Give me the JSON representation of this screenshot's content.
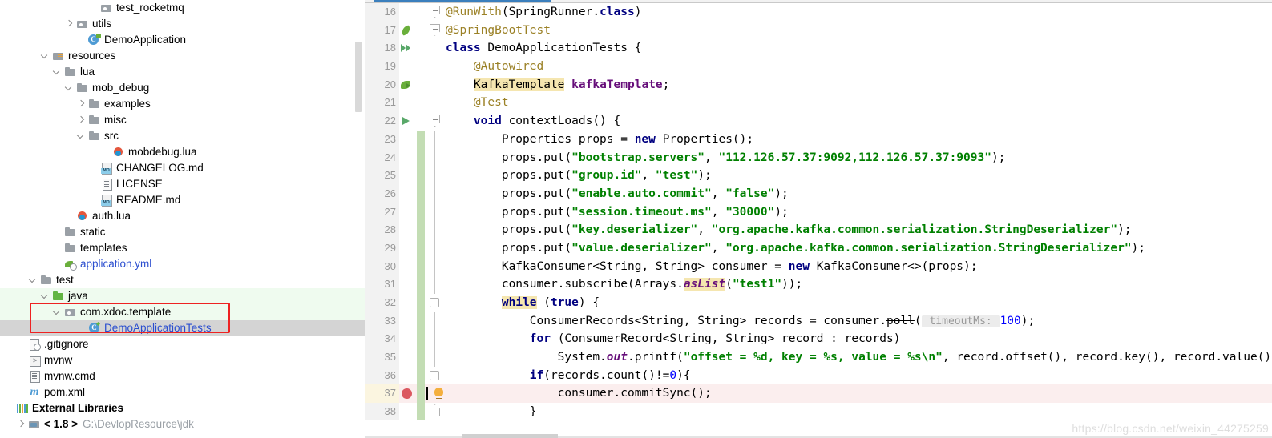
{
  "project_tree": {
    "name": "Project tool window",
    "scrollbar": true,
    "items": [
      {
        "label": "test_rocketmq",
        "indent": 7,
        "arrow": "none",
        "icon": "folder-dot-icon",
        "style": "plain"
      },
      {
        "label": "utils",
        "indent": 5,
        "arrow": "right",
        "icon": "folder-dot-icon",
        "style": "plain"
      },
      {
        "label": "DemoApplication",
        "indent": 6,
        "arrow": "none",
        "icon": "class-spring-icon",
        "style": "plain"
      },
      {
        "label": "resources",
        "indent": 3,
        "arrow": "down",
        "icon": "folder-resources-icon",
        "style": "plain"
      },
      {
        "label": "lua",
        "indent": 4,
        "arrow": "down",
        "icon": "folder-icon",
        "style": "plain"
      },
      {
        "label": "mob_debug",
        "indent": 5,
        "arrow": "down",
        "icon": "folder-icon",
        "style": "plain"
      },
      {
        "label": "examples",
        "indent": 6,
        "arrow": "right",
        "icon": "folder-icon",
        "style": "plain"
      },
      {
        "label": "misc",
        "indent": 6,
        "arrow": "right",
        "icon": "folder-icon",
        "style": "plain"
      },
      {
        "label": "src",
        "indent": 6,
        "arrow": "down",
        "icon": "folder-icon",
        "style": "plain"
      },
      {
        "label": "mobdebug.lua",
        "indent": 8,
        "arrow": "none",
        "icon": "lua-file-icon",
        "style": "plain"
      },
      {
        "label": "CHANGELOG.md",
        "indent": 7,
        "arrow": "none",
        "icon": "markdown-icon",
        "style": "plain"
      },
      {
        "label": "LICENSE",
        "indent": 7,
        "arrow": "none",
        "icon": "file-icon",
        "style": "plain"
      },
      {
        "label": "README.md",
        "indent": 7,
        "arrow": "none",
        "icon": "markdown-icon",
        "style": "plain"
      },
      {
        "label": "auth.lua",
        "indent": 5,
        "arrow": "none",
        "icon": "lua-file-icon",
        "style": "plain"
      },
      {
        "label": "static",
        "indent": 4,
        "arrow": "none",
        "icon": "folder-icon",
        "style": "plain"
      },
      {
        "label": "templates",
        "indent": 4,
        "arrow": "none",
        "icon": "folder-icon",
        "style": "plain"
      },
      {
        "label": "application.yml",
        "indent": 4,
        "arrow": "none",
        "icon": "yml-icon",
        "style": "blue"
      },
      {
        "label": "test",
        "indent": 2,
        "arrow": "down",
        "icon": "folder-icon",
        "style": "plain"
      },
      {
        "label": "java",
        "indent": 3,
        "arrow": "down",
        "icon": "folder-green-icon",
        "style": "plain",
        "row": "src-root"
      },
      {
        "label": "com.xdoc.template",
        "indent": 4,
        "arrow": "down",
        "icon": "folder-dot-icon",
        "style": "plain",
        "row": "src-root"
      },
      {
        "label": "DemoApplicationTests",
        "indent": 6,
        "arrow": "none",
        "icon": "class-icon",
        "style": "blue",
        "row": "selected"
      },
      {
        "label": ".gitignore",
        "indent": 1,
        "arrow": "none",
        "icon": "gitignore-icon",
        "style": "plain"
      },
      {
        "label": "mvnw",
        "indent": 1,
        "arrow": "none",
        "icon": "shell-script-icon",
        "style": "plain"
      },
      {
        "label": "mvnw.cmd",
        "indent": 1,
        "arrow": "none",
        "icon": "file-icon",
        "style": "plain"
      },
      {
        "label": "pom.xml",
        "indent": 1,
        "arrow": "none",
        "icon": "maven-icon",
        "style": "plain"
      },
      {
        "label": "External Libraries",
        "indent": 0,
        "arrow": "none",
        "icon": "external-libraries-icon",
        "style": "bold"
      },
      {
        "label": "< 1.8 >",
        "indent": 1,
        "arrow": "right",
        "icon": "jdk-icon",
        "style": "bold",
        "suffix": "G:\\DevlopResource\\jdk"
      }
    ],
    "annotation_box_color": "#ee2222"
  },
  "editor": {
    "name": "code-editor",
    "active_tab_indicator_color": "#3b7fbd",
    "lines": [
      {
        "num": "16",
        "gutter_icon": "none",
        "fold": "fold-tag",
        "tokens": [
          {
            "t": "@RunWith",
            "c": "anno"
          },
          {
            "t": "(SpringRunner.",
            "c": "plain"
          },
          {
            "t": "class",
            "c": "kw"
          },
          {
            "t": ")",
            "c": "plain"
          }
        ]
      },
      {
        "num": "17",
        "gutter_icon": "spring-leaf-icon",
        "fold": "fold-tag",
        "tokens": [
          {
            "t": "@SpringBootTest",
            "c": "anno"
          }
        ]
      },
      {
        "num": "18",
        "gutter_icon": "run-all-tests-icon",
        "fold": "none",
        "tokens": [
          {
            "t": "class",
            "c": "kw"
          },
          {
            "t": " DemoApplicationTests {",
            "c": "plain"
          }
        ]
      },
      {
        "num": "19",
        "gutter_icon": "none",
        "fold": "none",
        "tokens": [
          {
            "t": "    @Autowired",
            "c": "anno"
          }
        ]
      },
      {
        "num": "20",
        "gutter_icon": "spring-bean-icon",
        "fold": "none",
        "tokens": [
          {
            "t": "    ",
            "c": "plain"
          },
          {
            "t": "KafkaTemplate",
            "c": "hlsym"
          },
          {
            "t": " ",
            "c": "plain"
          },
          {
            "t": "kafkaTemplate",
            "c": "field"
          },
          {
            "t": ";",
            "c": "plain"
          }
        ]
      },
      {
        "num": "21",
        "gutter_icon": "none",
        "fold": "none",
        "tokens": [
          {
            "t": "    @Test",
            "c": "anno"
          }
        ]
      },
      {
        "num": "22",
        "gutter_icon": "run-test-icon",
        "fold": "fold-tag",
        "tokens": [
          {
            "t": "    ",
            "c": "plain"
          },
          {
            "t": "void",
            "c": "kw"
          },
          {
            "t": " contextLoads() {",
            "c": "plain"
          }
        ]
      },
      {
        "num": "23",
        "gutter_icon": "none",
        "fold": "line",
        "vcs": true,
        "tokens": [
          {
            "t": "        Properties props = ",
            "c": "plain"
          },
          {
            "t": "new",
            "c": "kw"
          },
          {
            "t": " Properties();",
            "c": "plain"
          }
        ]
      },
      {
        "num": "24",
        "gutter_icon": "none",
        "fold": "line",
        "vcs": true,
        "tokens": [
          {
            "t": "        props.put(",
            "c": "plain"
          },
          {
            "t": "\"bootstrap.servers\"",
            "c": "str"
          },
          {
            "t": ", ",
            "c": "plain"
          },
          {
            "t": "\"112.126.57.37:9092,112.126.57.37:9093\"",
            "c": "str"
          },
          {
            "t": ");",
            "c": "plain"
          }
        ]
      },
      {
        "num": "25",
        "gutter_icon": "none",
        "fold": "line",
        "vcs": true,
        "tokens": [
          {
            "t": "        props.put(",
            "c": "plain"
          },
          {
            "t": "\"group.id\"",
            "c": "str"
          },
          {
            "t": ", ",
            "c": "plain"
          },
          {
            "t": "\"test\"",
            "c": "str"
          },
          {
            "t": ");",
            "c": "plain"
          }
        ]
      },
      {
        "num": "26",
        "gutter_icon": "none",
        "fold": "line",
        "vcs": true,
        "tokens": [
          {
            "t": "        props.put(",
            "c": "plain"
          },
          {
            "t": "\"enable.auto.commit\"",
            "c": "str"
          },
          {
            "t": ", ",
            "c": "plain"
          },
          {
            "t": "\"false\"",
            "c": "str"
          },
          {
            "t": ");",
            "c": "plain"
          }
        ]
      },
      {
        "num": "27",
        "gutter_icon": "none",
        "fold": "line",
        "vcs": true,
        "tokens": [
          {
            "t": "        props.put(",
            "c": "plain"
          },
          {
            "t": "\"session.timeout.ms\"",
            "c": "str"
          },
          {
            "t": ", ",
            "c": "plain"
          },
          {
            "t": "\"30000\"",
            "c": "str"
          },
          {
            "t": ");",
            "c": "plain"
          }
        ]
      },
      {
        "num": "28",
        "gutter_icon": "none",
        "fold": "line",
        "vcs": true,
        "tokens": [
          {
            "t": "        props.put(",
            "c": "plain"
          },
          {
            "t": "\"key.deserializer\"",
            "c": "str"
          },
          {
            "t": ", ",
            "c": "plain"
          },
          {
            "t": "\"org.apache.kafka.common.serialization.StringDeserializer\"",
            "c": "str"
          },
          {
            "t": ");",
            "c": "plain"
          }
        ]
      },
      {
        "num": "29",
        "gutter_icon": "none",
        "fold": "line",
        "vcs": true,
        "tokens": [
          {
            "t": "        props.put(",
            "c": "plain"
          },
          {
            "t": "\"value.deserializer\"",
            "c": "str"
          },
          {
            "t": ", ",
            "c": "plain"
          },
          {
            "t": "\"org.apache.kafka.common.serialization.StringDeserializer\"",
            "c": "str"
          },
          {
            "t": ");",
            "c": "plain"
          }
        ]
      },
      {
        "num": "30",
        "gutter_icon": "none",
        "fold": "line",
        "vcs": true,
        "tokens": [
          {
            "t": "        KafkaConsumer<String, String> consumer = ",
            "c": "plain"
          },
          {
            "t": "new",
            "c": "kw"
          },
          {
            "t": " KafkaConsumer<>(props);",
            "c": "plain"
          }
        ]
      },
      {
        "num": "31",
        "gutter_icon": "none",
        "fold": "line",
        "vcs": true,
        "tokens": [
          {
            "t": "        consumer.subscribe(Arrays.",
            "c": "plain"
          },
          {
            "t": "asList",
            "c": "static-it-hl"
          },
          {
            "t": "(",
            "c": "plain"
          },
          {
            "t": "\"test1\"",
            "c": "str"
          },
          {
            "t": "));",
            "c": "plain"
          }
        ]
      },
      {
        "num": "32",
        "gutter_icon": "none",
        "fold": "fold-minus",
        "vcs": true,
        "tokens": [
          {
            "t": "        ",
            "c": "plain"
          },
          {
            "t": "while",
            "c": "kw-hl"
          },
          {
            "t": " (",
            "c": "plain"
          },
          {
            "t": "true",
            "c": "kw"
          },
          {
            "t": ") {",
            "c": "plain"
          }
        ]
      },
      {
        "num": "33",
        "gutter_icon": "none",
        "fold": "line",
        "vcs": true,
        "tokens": [
          {
            "t": "            ConsumerRecords<String, String> records = consumer.",
            "c": "plain"
          },
          {
            "t": "poll",
            "c": "deprecated"
          },
          {
            "t": "(",
            "c": "plain"
          },
          {
            "t": " timeoutMs: ",
            "c": "hint"
          },
          {
            "t": "100",
            "c": "num"
          },
          {
            "t": ");",
            "c": "plain"
          }
        ]
      },
      {
        "num": "34",
        "gutter_icon": "none",
        "fold": "line",
        "vcs": true,
        "tokens": [
          {
            "t": "            ",
            "c": "plain"
          },
          {
            "t": "for",
            "c": "kw"
          },
          {
            "t": " (ConsumerRecord<String, String> record : records)",
            "c": "plain"
          }
        ]
      },
      {
        "num": "35",
        "gutter_icon": "none",
        "fold": "line",
        "vcs": true,
        "tokens": [
          {
            "t": "                System.",
            "c": "plain"
          },
          {
            "t": "out",
            "c": "static-it"
          },
          {
            "t": ".printf(",
            "c": "plain"
          },
          {
            "t": "\"offset = %d, key = %s, value = %s\\n\"",
            "c": "str"
          },
          {
            "t": ", record.offset(), record.key(), record.value()",
            "c": "plain"
          }
        ]
      },
      {
        "num": "36",
        "gutter_icon": "none",
        "fold": "fold-minus",
        "vcs": true,
        "tokens": [
          {
            "t": "            ",
            "c": "plain"
          },
          {
            "t": "if",
            "c": "kw"
          },
          {
            "t": "(records.count()!=",
            "c": "plain"
          },
          {
            "t": "0",
            "c": "num"
          },
          {
            "t": "){",
            "c": "plain"
          }
        ]
      },
      {
        "num": "37",
        "gutter_icon": "breakpoint-icon",
        "fold": "bulb",
        "vcs": true,
        "highlight": true,
        "tokens": [
          {
            "t": "                consumer.commitSync();",
            "c": "plain"
          }
        ]
      },
      {
        "num": "38",
        "gutter_icon": "none",
        "fold": "fold-end",
        "vcs": true,
        "tokens": [
          {
            "t": "            }",
            "c": "plain"
          }
        ]
      }
    ],
    "watermark": "https://blog.csdn.net/weixin_44275259"
  }
}
